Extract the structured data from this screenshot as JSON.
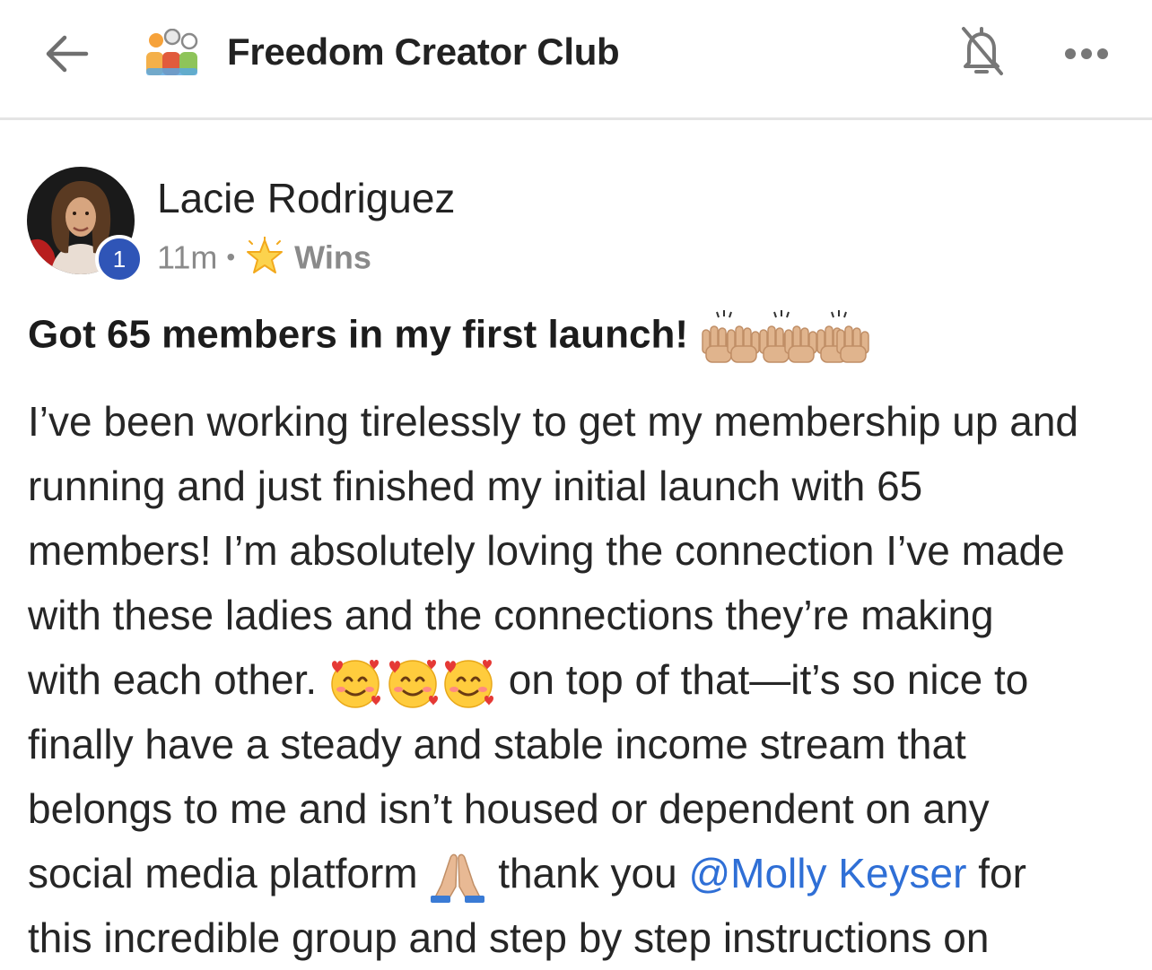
{
  "header": {
    "back_icon": "arrow-left-icon",
    "group_icon": "group-people-icon",
    "title": "Freedom Creator Club",
    "notifications_icon": "bell-off-icon",
    "more_icon": "more-horizontal-icon"
  },
  "post": {
    "author": {
      "name": "Lacie Rodriguez",
      "level": "1",
      "avatar_icon": "avatar-photo"
    },
    "time": "11m",
    "separator": "•",
    "category_icon": "glowing-star-icon",
    "category": "Wins",
    "title": "Got 65 members in my first launch!",
    "title_emoji": "raising-hands-emoji",
    "body": {
      "line1": "I’ve been working tirelessly to get my membership up and",
      "line2": "running and just finished my initial launch with 65",
      "line3": "members! I’m absolutely loving the connection I’ve made",
      "line4": "with these ladies and the connections they’re making",
      "line5_before": "with each other.",
      "line5_emoji": "smiling-face-with-hearts-emoji",
      "line5_after": "on top of that—it’s so nice to",
      "line6": "finally have a steady and stable income stream that",
      "line7": "belongs to me and isn’t housed or dependent on any",
      "line8_before": "social media platform",
      "line8_emoji": "folded-hands-emoji",
      "line8_middle": "thank you",
      "mention": "@Molly Keyser",
      "line8_after": "for",
      "line9": "this incredible group and step by step instructions on"
    }
  },
  "colors": {
    "mention": "#2f6fd6",
    "level_badge": "#2f55b7",
    "divider": "#e4e4e4",
    "meta_text": "#8a8a8a"
  }
}
